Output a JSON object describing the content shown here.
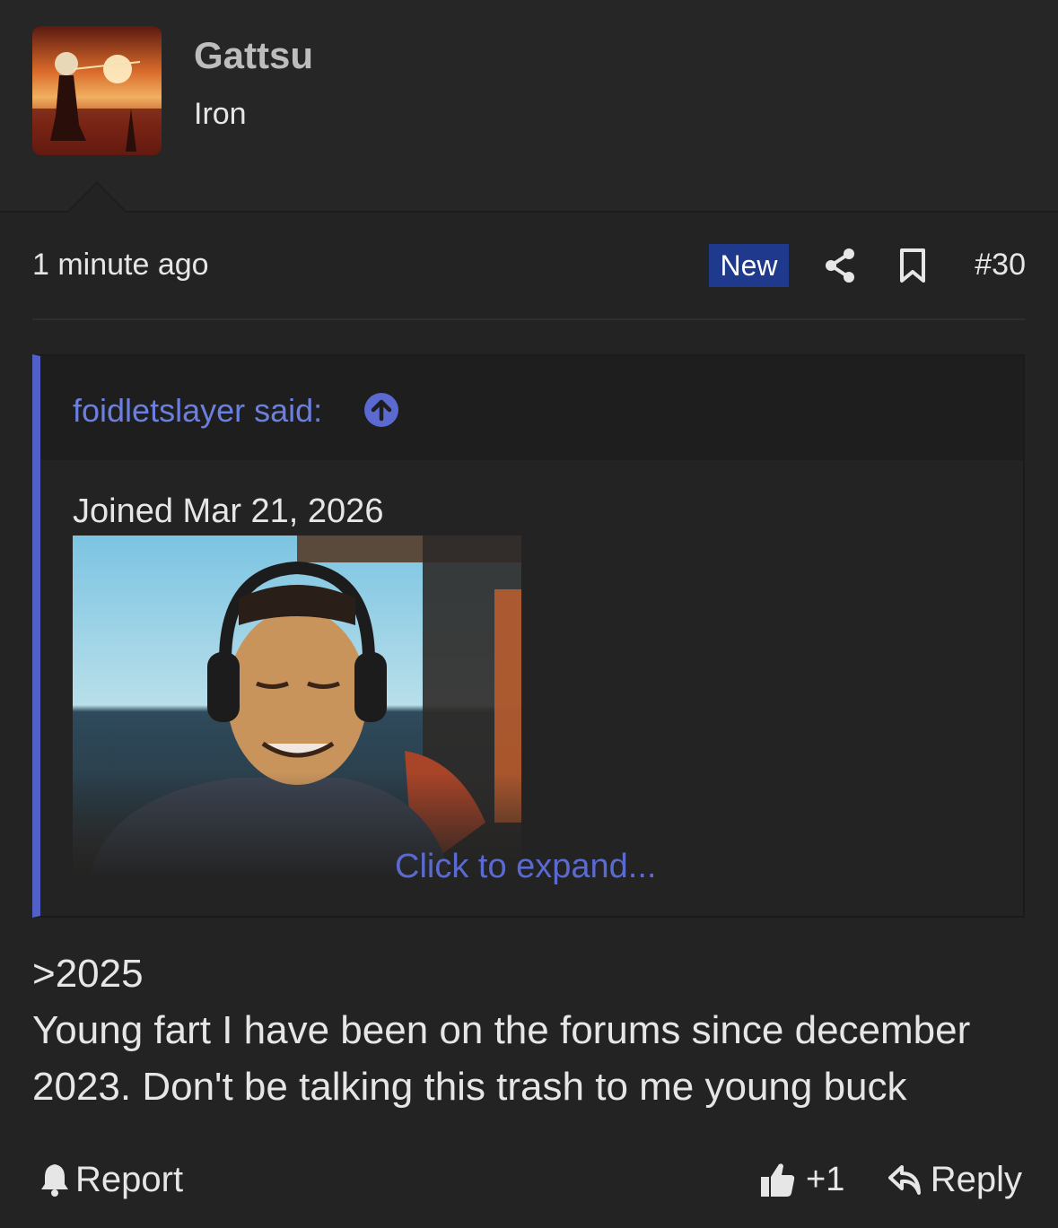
{
  "author": {
    "username": "Gattsu",
    "user_title": "Iron",
    "avatar_icon": "silhouette-sunset-avatar"
  },
  "post_meta": {
    "timestamp": "1 minute ago",
    "new_badge": "New",
    "post_number": "#30",
    "share_icon": "share-icon",
    "bookmark_icon": "bookmark-icon"
  },
  "quote": {
    "author_label": "foidletslayer said:",
    "text": "Joined Mar 21, 2026",
    "image_icon": "smiling-man-headphones-gif",
    "expand_label": "Click to expand..."
  },
  "body": {
    "lines": [
      ">2025",
      "Young fart I have been on the forums since december",
      "2023. Don't be talking this trash to me young buck"
    ]
  },
  "footer": {
    "report_label": "Report",
    "like_count": "+1",
    "reply_label": "Reply"
  },
  "colors": {
    "background": "#232323",
    "accent": "#5060c8",
    "link": "#6b7fe0",
    "badge": "#1f3a8c"
  }
}
